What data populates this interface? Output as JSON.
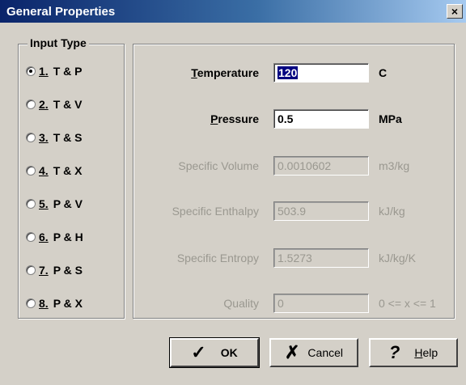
{
  "window": {
    "title": "General Properties",
    "close_glyph": "×"
  },
  "input_type": {
    "legend": "Input Type",
    "options": [
      {
        "num": "1.",
        "label": "T & P",
        "checked": true
      },
      {
        "num": "2.",
        "label": "T & V",
        "checked": false
      },
      {
        "num": "3.",
        "label": "T & S",
        "checked": false
      },
      {
        "num": "4.",
        "label": "T & X",
        "checked": false
      },
      {
        "num": "5.",
        "label": "P & V",
        "checked": false
      },
      {
        "num": "6.",
        "label": "P & H",
        "checked": false
      },
      {
        "num": "7.",
        "label": "P & S",
        "checked": false
      },
      {
        "num": "8.",
        "label": "P & X",
        "checked": false
      }
    ]
  },
  "properties": {
    "temperature": {
      "label_key": "T",
      "label_rest": "emperature",
      "value": "120",
      "unit": "C",
      "enabled": true
    },
    "pressure": {
      "label_key": "P",
      "label_rest": "ressure",
      "value": "0.5",
      "unit": "MPa",
      "enabled": true
    },
    "specific_volume": {
      "label": "Specific Volume",
      "value": "0.0010602",
      "unit": "m3/kg",
      "enabled": false
    },
    "specific_enthalpy": {
      "label": "Specific Enthalpy",
      "value": "503.9",
      "unit": "kJ/kg",
      "enabled": false
    },
    "specific_entropy": {
      "label": "Specific Entropy",
      "value": "1.5273",
      "unit": "kJ/kg/K",
      "enabled": false
    },
    "quality": {
      "label": "Quality",
      "value": "0",
      "unit": "0 <= x <= 1",
      "enabled": false
    }
  },
  "buttons": {
    "ok": {
      "label": "OK",
      "icon": "checkmark-icon",
      "glyph": "✓"
    },
    "cancel": {
      "label": "Cancel",
      "icon": "x-mark-icon",
      "glyph": "✗"
    },
    "help": {
      "label_key": "H",
      "label_rest": "elp",
      "icon": "question-mark-icon",
      "glyph": "?"
    }
  }
}
